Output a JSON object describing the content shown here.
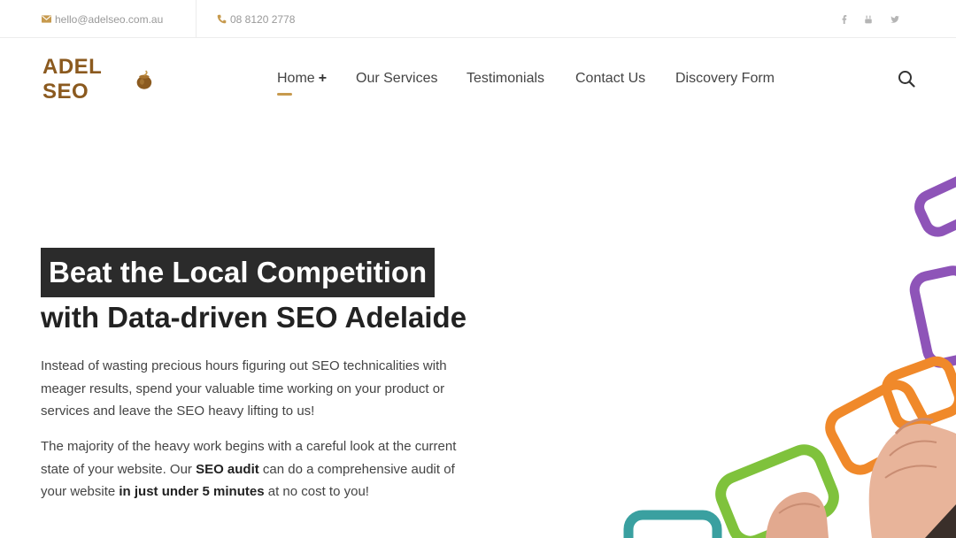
{
  "topbar": {
    "email": "hello@adelseo.com.au",
    "phone": "08 8120 2778",
    "social": [
      "facebook-icon",
      "youtube-icon",
      "twitter-icon"
    ]
  },
  "header": {
    "logo_text": "ADEL SEO",
    "nav": [
      {
        "label": "Home",
        "active": true,
        "has_submenu": true,
        "submenu_marker": "+"
      },
      {
        "label": "Our Services"
      },
      {
        "label": "Testimonials"
      },
      {
        "label": "Contact Us"
      },
      {
        "label": "Discovery Form"
      }
    ]
  },
  "hero": {
    "title_highlight": "Beat the Local Competition",
    "title_rest": "with Data-driven SEO Adelaide",
    "paragraph1": "Instead of wasting precious hours figuring out SEO technicalities with meager results, spend your valuable time working on your product or services and leave the SEO heavy lifting to us!",
    "paragraph2": {
      "part1": "The majority of the heavy work begins with a careful look at the current state of your website. Our ",
      "bold1": "SEO audit",
      "part2": " can do a comprehensive audit of your website ",
      "bold2": "in just under 5 minutes",
      "part3": " at no cost to you!"
    }
  },
  "colors": {
    "accent": "#c79a4e",
    "logo": "#8b5a1f",
    "title_bg": "#2b2b2b",
    "chain_purple": "#8e54b8",
    "chain_orange": "#f0892a",
    "chain_green": "#7fc23c",
    "chain_teal": "#3aa0a0"
  }
}
